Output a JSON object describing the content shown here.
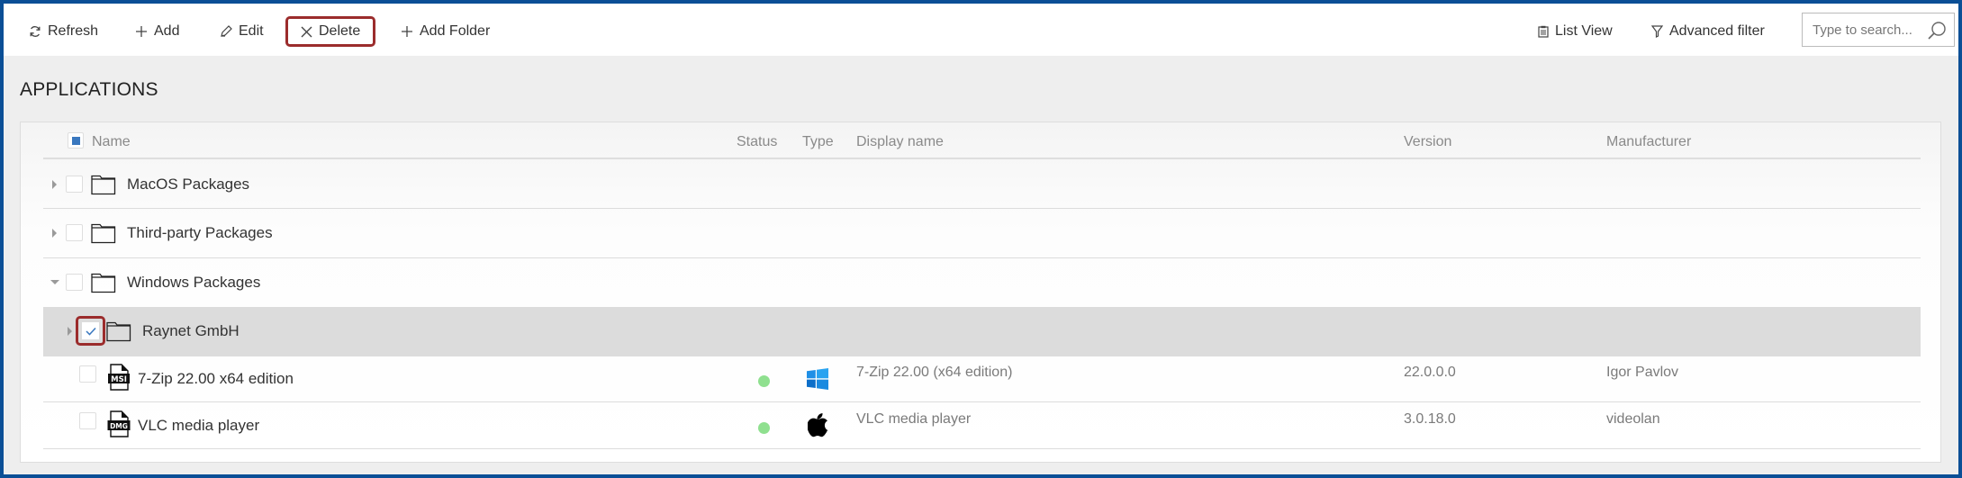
{
  "toolbar": {
    "buttons": [
      {
        "label": "Refresh",
        "icon": "refresh-icon"
      },
      {
        "label": "Add",
        "icon": "plus-icon"
      },
      {
        "label": "Edit",
        "icon": "pencil-icon"
      },
      {
        "label": "Delete",
        "icon": "close-icon",
        "highlighted": true
      },
      {
        "label": "Add Folder",
        "icon": "plus-icon"
      }
    ],
    "right_buttons": [
      {
        "label": "List View",
        "icon": "clipboard-icon"
      },
      {
        "label": "Advanced filter",
        "icon": "filter-icon"
      }
    ],
    "search": {
      "placeholder": "Type to search...",
      "value": "",
      "icon": "search-icon"
    }
  },
  "page": {
    "title": "APPLICATIONS"
  },
  "table": {
    "columns": [
      "Name",
      "Status",
      "Type",
      "Display name",
      "Version",
      "Manufacturer"
    ],
    "header_checkbox": "indeterminate",
    "rows": [
      {
        "kind": "folder",
        "name": "MacOS Packages",
        "expanded": false,
        "checked": false,
        "level": 0
      },
      {
        "kind": "folder",
        "name": "Third-party Packages",
        "expanded": false,
        "checked": false,
        "level": 0
      },
      {
        "kind": "folder",
        "name": "Windows Packages",
        "expanded": true,
        "checked": false,
        "level": 0
      },
      {
        "kind": "folder",
        "name": "Raynet GmbH",
        "expanded": false,
        "checked": true,
        "selected": true,
        "level": 1
      },
      {
        "kind": "package",
        "file_type": "MSI",
        "name": "7-Zip 22.00 x64 edition",
        "status": "active",
        "status_color": "#8fe08f",
        "type": "windows",
        "display_name": "7-Zip 22.00 (x64 edition)",
        "version": "22.0.0.0",
        "manufacturer": "Igor Pavlov"
      },
      {
        "kind": "package",
        "file_type": "DMG",
        "name": "VLC media player",
        "status": "active",
        "status_color": "#8fe08f",
        "type": "macos",
        "display_name": "VLC media player",
        "version": "3.0.18.0",
        "manufacturer": "videolan"
      }
    ]
  },
  "colors": {
    "frame_border": "#0b4f96",
    "highlight_outline": "#9b2c2c",
    "checkbox_accent": "#3a78bf",
    "status_active": "#8fe08f",
    "windows_blue": "#1f8fe6"
  }
}
